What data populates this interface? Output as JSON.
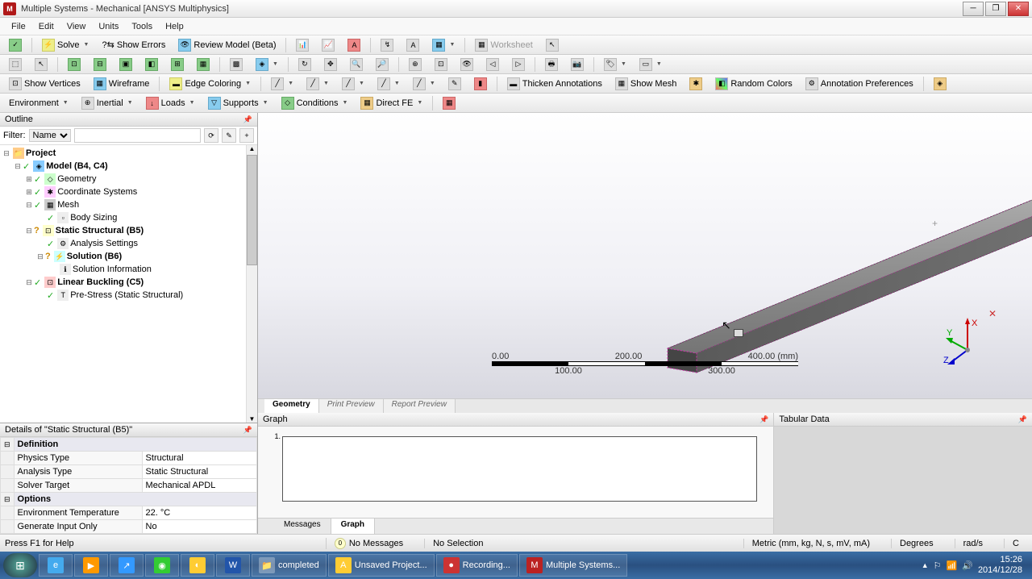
{
  "window": {
    "title": "Multiple Systems - Mechanical [ANSYS Multiphysics]",
    "icon": "M"
  },
  "menu": [
    "File",
    "Edit",
    "View",
    "Units",
    "Tools",
    "Help"
  ],
  "tb1": {
    "solve": "Solve",
    "errors": "?⇆ Show Errors",
    "review": "Review Model (Beta)",
    "worksheet": "Worksheet"
  },
  "tb3": {
    "vertices": "Show Vertices",
    "wireframe": "Wireframe",
    "edgecolor": "Edge Coloring",
    "thicken": "Thicken Annotations",
    "showmesh": "Show Mesh",
    "random": "Random Colors",
    "anno": "Annotation Preferences"
  },
  "tb4": {
    "env": "Environment",
    "inertial": "Inertial",
    "loads": "Loads",
    "supports": "Supports",
    "conditions": "Conditions",
    "directfe": "Direct FE"
  },
  "outline": {
    "title": "Outline",
    "filter_label": "Filter:",
    "filter_value": "Name",
    "tree": {
      "project": "Project",
      "model": "Model (B4, C4)",
      "geometry": "Geometry",
      "coord": "Coordinate Systems",
      "mesh": "Mesh",
      "bodysizing": "Body Sizing",
      "static": "Static Structural (B5)",
      "analysis": "Analysis Settings",
      "solution": "Solution (B6)",
      "solinfo": "Solution Information",
      "linear": "Linear Buckling (C5)",
      "prestress": "Pre-Stress (Static Structural)"
    }
  },
  "details": {
    "title": "Details of \"Static Structural (B5)\"",
    "definition": "Definition",
    "physics_type": "Physics Type",
    "physics_type_v": "Structural",
    "analysis_type": "Analysis Type",
    "analysis_type_v": "Static Structural",
    "solver": "Solver Target",
    "solver_v": "Mechanical APDL",
    "options": "Options",
    "envtemp": "Environment Temperature",
    "envtemp_v": "22. °C",
    "geninput": "Generate Input Only",
    "geninput_v": "No"
  },
  "view": {
    "scale": {
      "t0": "0.00",
      "t1": "100.00",
      "t2": "200.00",
      "t3": "300.00",
      "t4": "400.00 (mm)"
    },
    "triad": {
      "x": "X",
      "y": "Y",
      "z": "Z"
    },
    "tabs": {
      "geom": "Geometry",
      "print": "Print Preview",
      "report": "Report Preview"
    }
  },
  "graph": {
    "title": "Graph",
    "ytick": "1."
  },
  "tabular": {
    "title": "Tabular Data"
  },
  "btabs": {
    "messages": "Messages",
    "graph": "Graph"
  },
  "status": {
    "help": "Press F1 for Help",
    "msgs": "No Messages",
    "sel": "No Selection",
    "units": "Metric (mm, kg, N, s, mV, mA)",
    "deg": "Degrees",
    "rad": "rad/s",
    "c": "C"
  },
  "taskbar": {
    "apps": [
      {
        "label": "completed",
        "icon": "📁"
      },
      {
        "label": "Unsaved Project...",
        "icon": "A"
      },
      {
        "label": "Recording...",
        "icon": "●"
      },
      {
        "label": "Multiple Systems...",
        "icon": "M"
      }
    ],
    "time": "15:26",
    "date": "2014/12/28"
  }
}
